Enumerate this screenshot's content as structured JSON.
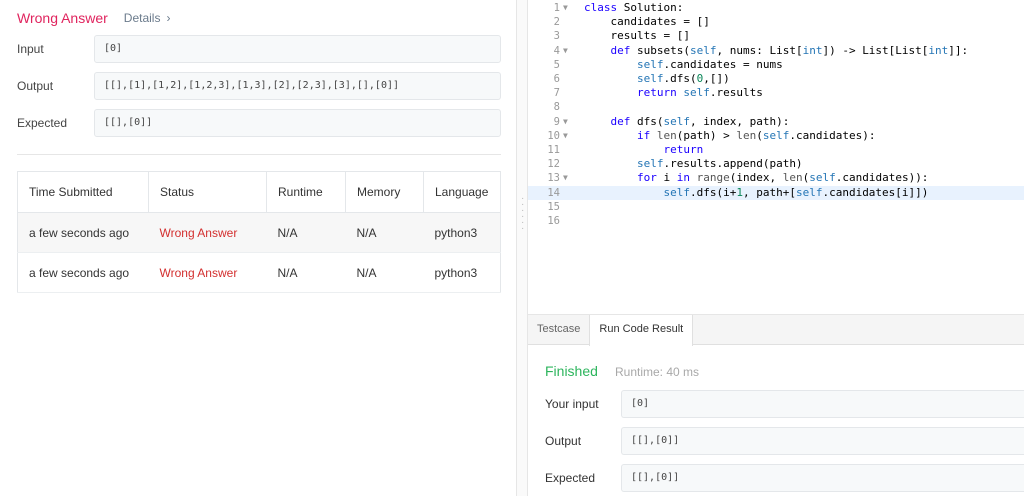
{
  "submission": {
    "status": "Wrong Answer",
    "details_link": "Details",
    "input_label": "Input",
    "input_value": "[0]",
    "output_label": "Output",
    "output_value": "[[],[1],[1,2],[1,2,3],[1,3],[2],[2,3],[3],[],[0]]",
    "expected_label": "Expected",
    "expected_value": "[[],[0]]"
  },
  "submissions_table": {
    "headers": [
      "Time Submitted",
      "Status",
      "Runtime",
      "Memory",
      "Language"
    ],
    "rows": [
      [
        "a few seconds ago",
        "Wrong Answer",
        "N/A",
        "N/A",
        "python3"
      ],
      [
        "a few seconds ago",
        "Wrong Answer",
        "N/A",
        "N/A",
        "python3"
      ]
    ]
  },
  "editor": {
    "active_line": 14,
    "lines": [
      {
        "n": "1",
        "fold": true
      },
      {
        "n": "2",
        "fold": false
      },
      {
        "n": "3",
        "fold": false
      },
      {
        "n": "4",
        "fold": true
      },
      {
        "n": "5",
        "fold": false
      },
      {
        "n": "6",
        "fold": false
      },
      {
        "n": "7",
        "fold": false
      },
      {
        "n": "8",
        "fold": false
      },
      {
        "n": "9",
        "fold": true
      },
      {
        "n": "10",
        "fold": true
      },
      {
        "n": "11",
        "fold": false
      },
      {
        "n": "12",
        "fold": false
      },
      {
        "n": "13",
        "fold": true
      },
      {
        "n": "14",
        "fold": false
      },
      {
        "n": "15",
        "fold": false
      },
      {
        "n": "16",
        "fold": false
      }
    ]
  },
  "result_panel": {
    "tabs": [
      "Testcase",
      "Run Code Result"
    ],
    "active_tab": "Run Code Result",
    "status": "Finished",
    "runtime": "Runtime: 40 ms",
    "input_label": "Your input",
    "input_value": "[0]",
    "output_label": "Output",
    "output_value": "[[],[0]]",
    "expected_label": "Expected",
    "expected_value": "[[],[0]]"
  },
  "colors": {
    "wrong_answer": "#e0245e",
    "finished": "#2db55d",
    "active_line": "#e8f2fe"
  }
}
